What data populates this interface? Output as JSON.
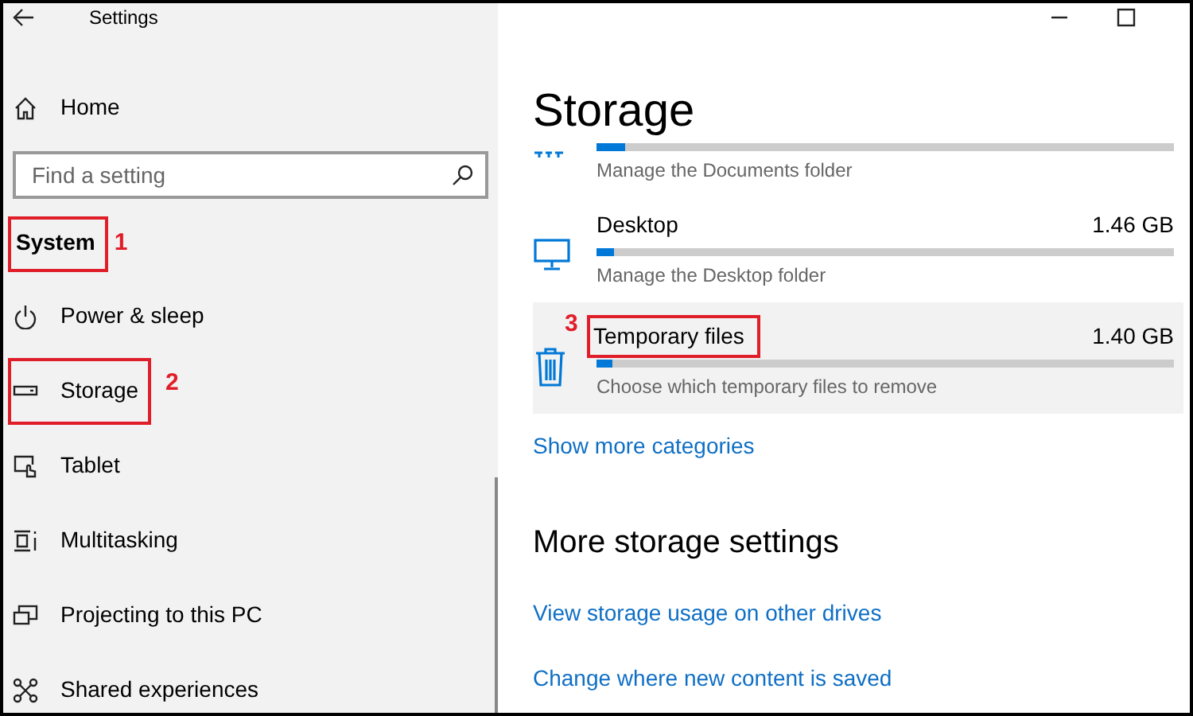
{
  "window": {
    "title": "Settings"
  },
  "sidebar": {
    "home": "Home",
    "search": {
      "placeholder": "Find a setting"
    },
    "section": {
      "label": "System",
      "annotation": "1"
    },
    "items": [
      {
        "label": "Power & sleep"
      },
      {
        "label": "Storage",
        "annotation": "2"
      },
      {
        "label": "Tablet"
      },
      {
        "label": "Multitasking"
      },
      {
        "label": "Projecting to this PC"
      },
      {
        "label": "Shared experiences"
      }
    ]
  },
  "page": {
    "title": "Storage",
    "categories": [
      {
        "description": "Manage the Documents folder",
        "level": 0.05,
        "highlighted": false
      },
      {
        "name": "Desktop",
        "size": "1.46 GB",
        "level": 0.03,
        "description": "Manage the Desktop folder",
        "highlighted": false
      },
      {
        "name": "Temporary files",
        "size": "1.40 GB",
        "level": 0.027,
        "description": "Choose which temporary files to remove",
        "highlighted": true,
        "annotation": "3"
      }
    ],
    "show_more": "Show more categories",
    "more_settings": {
      "title": "More storage settings",
      "links": [
        "View storage usage on other drives",
        "Change where new content is saved"
      ]
    }
  }
}
